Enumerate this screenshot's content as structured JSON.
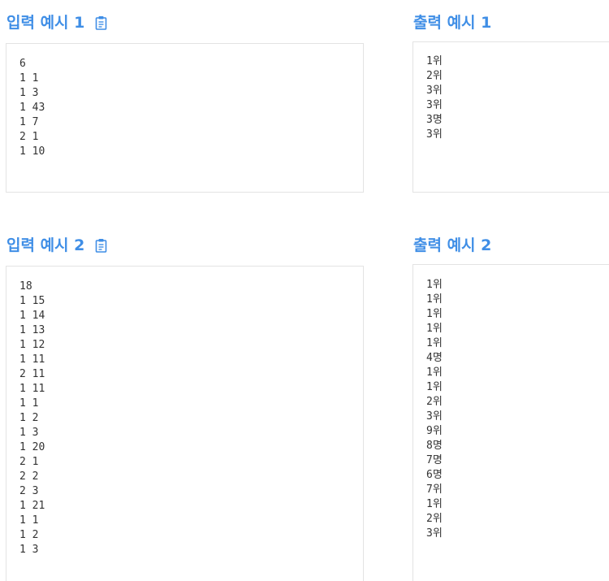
{
  "sample_input_1": {
    "title": "입력 예시 1",
    "content": "6\n1 1\n1 3\n1 43\n1 7\n2 1\n1 10"
  },
  "sample_output_1": {
    "title": "출력 예시 1",
    "content": "1위\n2위\n3위\n3위\n3명\n3위"
  },
  "sample_input_2": {
    "title": "입력 예시 2",
    "content": "18\n1 15\n1 14\n1 13\n1 12\n1 11\n2 11\n1 11\n1 1\n1 2\n1 3\n1 20\n2 1\n2 2\n2 3\n1 21\n1 1\n1 2\n1 3"
  },
  "sample_output_2": {
    "title": "출력 예시 2",
    "content": "1위\n1위\n1위\n1위\n1위\n4명\n1위\n1위\n2위\n3위\n9위\n8명\n7명\n6명\n7위\n1위\n2위\n3위"
  },
  "colors": {
    "heading": "#3f8ee6",
    "border": "#e3e3e3",
    "text": "#333333"
  },
  "icons": {
    "copy": "clipboard-icon"
  }
}
